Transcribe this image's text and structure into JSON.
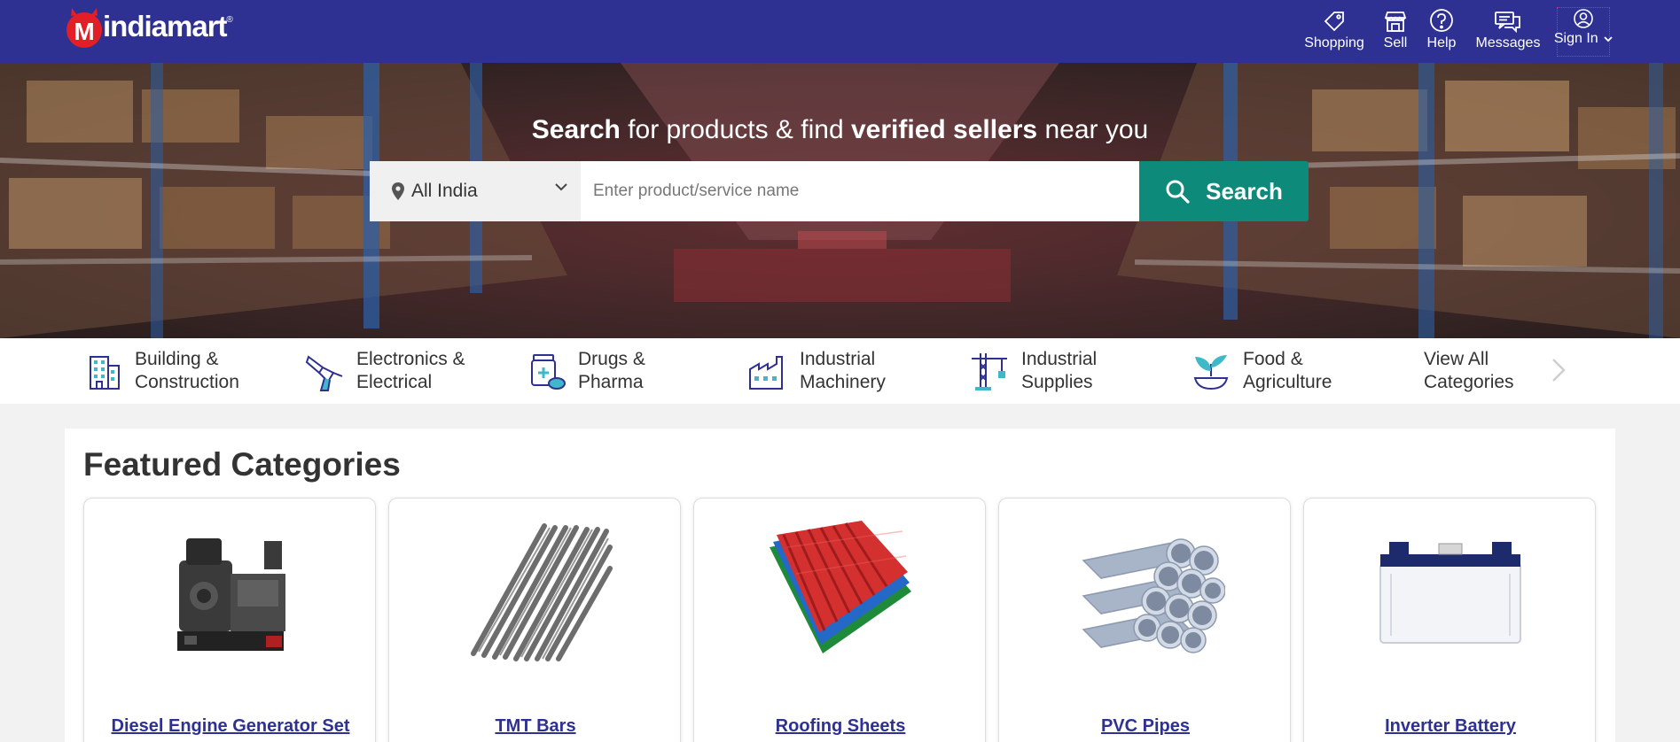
{
  "header": {
    "logo_text": "indiamart",
    "logo_reg": "®",
    "nav": [
      {
        "label": "Shopping",
        "icon": "tag-icon"
      },
      {
        "label": "Sell",
        "icon": "store-icon"
      },
      {
        "label": "Help",
        "icon": "help-circle-icon"
      },
      {
        "label": "Messages",
        "icon": "messages-icon"
      },
      {
        "label": "Sign In",
        "icon": "user-circle-icon"
      }
    ],
    "colors": {
      "bar": "#2e3192",
      "signin_outline": "#e0267a"
    }
  },
  "hero": {
    "title_parts": [
      "Search",
      " for products & find ",
      "verified sellers",
      " near you"
    ],
    "location": "All India",
    "search_placeholder": "Enter product/service name",
    "search_button": "Search",
    "colors": {
      "search_button": "#0e8a7a"
    }
  },
  "categories": [
    {
      "line1": "Building &",
      "line2": "Construction",
      "icon": "building-icon"
    },
    {
      "line1": "Electronics &",
      "line2": "Electrical",
      "icon": "drill-icon"
    },
    {
      "line1": "Drugs &",
      "line2": "Pharma",
      "icon": "medicine-icon"
    },
    {
      "line1": "Industrial",
      "line2": "Machinery",
      "icon": "factory-icon"
    },
    {
      "line1": "Industrial",
      "line2": "Supplies",
      "icon": "crane-icon"
    },
    {
      "line1": "Food &",
      "line2": "Agriculture",
      "icon": "sprout-icon"
    },
    {
      "line1": "View All",
      "line2": "Categories",
      "icon": ""
    }
  ],
  "featured": {
    "title": "Featured Categories",
    "items": [
      {
        "name": "Diesel Engine Generator Set",
        "image": "generator-image"
      },
      {
        "name": "TMT Bars",
        "image": "tmt-bars-image"
      },
      {
        "name": "Roofing Sheets",
        "image": "roofing-sheets-image"
      },
      {
        "name": "PVC Pipes",
        "image": "pvc-pipes-image"
      },
      {
        "name": "Inverter Battery",
        "image": "inverter-battery-image"
      }
    ]
  }
}
